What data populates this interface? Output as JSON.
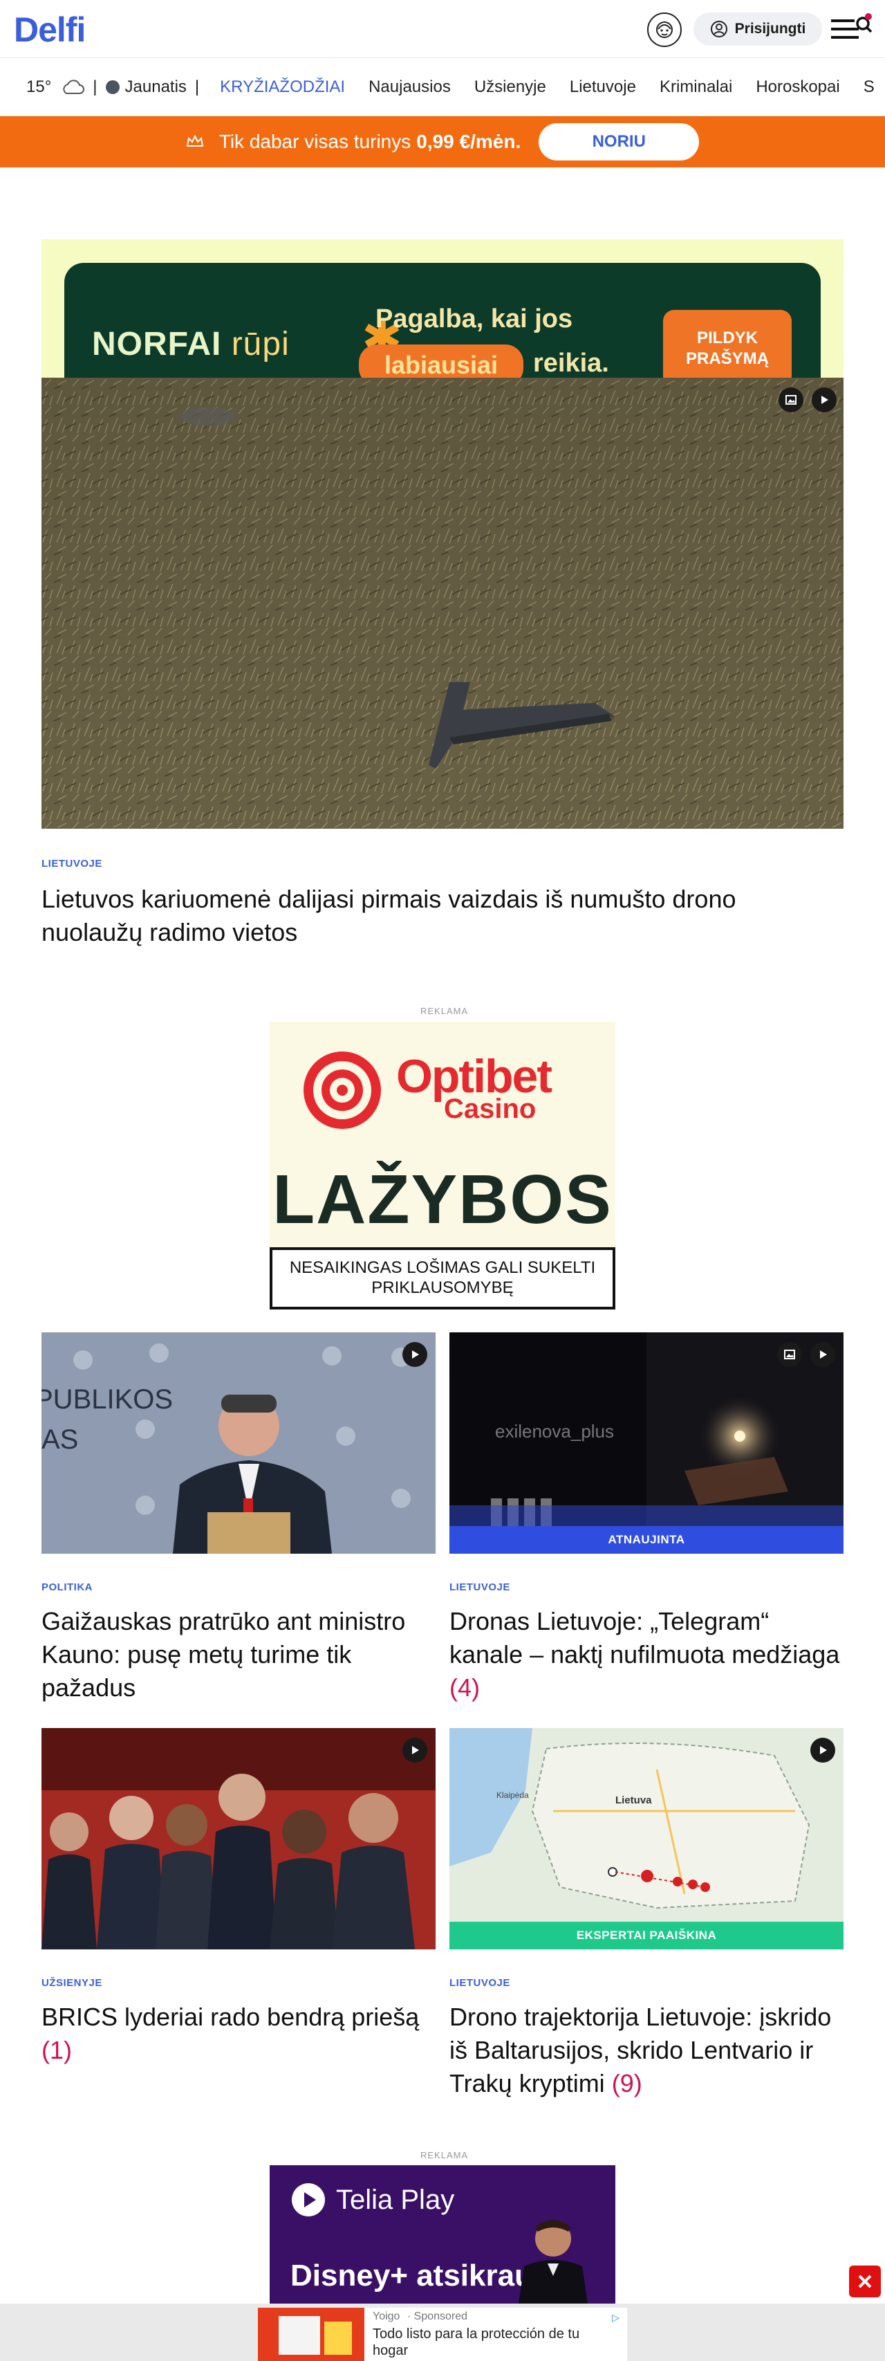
{
  "header": {
    "logo": "Delfi",
    "login_label": "Prisijungti"
  },
  "nav": {
    "temperature": "15°",
    "user_name": "Jaunatis",
    "items": [
      "KRYŽIAŽODŽIAI",
      "Naujausios",
      "Užsienyje",
      "Lietuvoje",
      "Kriminalai",
      "Horoskopai",
      "S"
    ]
  },
  "promo": {
    "text": "Tik dabar visas turinys",
    "price": "0,99 €/mėn.",
    "button": "NORIU"
  },
  "top_ad": {
    "brand": "NORFAI",
    "brand_suffix": "rūpi",
    "line1": "Pagalba, kai jos",
    "highlight": "labiausiai",
    "line2_end": "reikia.",
    "cta": "PILDYK PRAŠYMĄ"
  },
  "hero": {
    "category": "LIETUVOJE",
    "title": "Lietuvos kariuomenė dalijasi pirmais vaizdais iš numušto drono nuolaužų radimo vietos"
  },
  "ad1": {
    "label": "REKLAMA",
    "brand": "Optibet",
    "brand_sub": "Casino",
    "headline": "LAŽYBOS",
    "warning": "NESAIKINGAS LOŠIMAS GALI SUKELTI PRIKLAUSOMYBĘ"
  },
  "cards": [
    {
      "category": "POLITIKA",
      "title": "Gaižauskas pratrūko ant ministro Kauno: pusę metų turime tik pažadus",
      "comments": "",
      "strip": ""
    },
    {
      "category": "LIETUVOJE",
      "title": "Dronas Lietuvoje: „Telegram“ kanale – naktį nufilmuota medžiaga",
      "comments": "(4)",
      "strip": "ATNAUJINTA",
      "watermark": "exilenova_plus"
    },
    {
      "category": "UŽSIENYJE",
      "title": "BRICS lyderiai rado bendrą priešą",
      "comments": "(1)",
      "strip": ""
    },
    {
      "category": "LIETUVOJE",
      "title": "Drono trajektorija Lietuvoje: įskrido iš Baltarusijos, skrido Lentvario ir Trakų kryptimi",
      "comments": "(9)",
      "strip": "EKSPERTAI PAAIŠKINA",
      "map_label": "Lietuva",
      "map_city": "Klaipėda"
    }
  ],
  "ad2": {
    "label": "REKLAMA",
    "brand": "Telia Play",
    "headline": "Disney+ atsikraustė"
  },
  "bottom_ad": {
    "brand": "Yoigo",
    "sponsored": "Sponsored",
    "title": "Todo listo para la protección de tu hogar"
  },
  "colors": {
    "brand_blue": "#3a5fd9",
    "promo_orange": "#f36b10",
    "comment_red": "#d0114f"
  }
}
